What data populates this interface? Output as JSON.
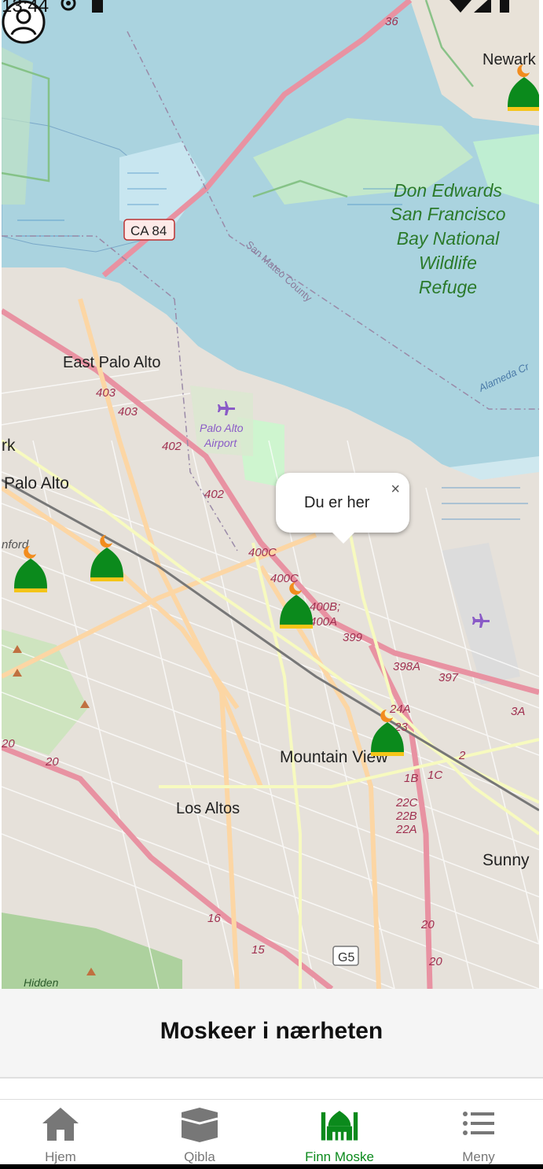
{
  "status_bar": {
    "time": "13:44"
  },
  "map": {
    "labels": {
      "newark": "Newark",
      "refuge_line1": "Don Edwards",
      "refuge_line2": "San Francisco",
      "refuge_line3": "Bay National",
      "refuge_line4": "Wildlife",
      "refuge_line5": "Refuge",
      "ca84": "CA 84",
      "san_mateo_county": "San Mateo County",
      "east_palo_alto": "East Palo Alto",
      "palo_alto_airport_1": "Palo Alto",
      "palo_alto_airport_2": "Airport",
      "palo_alto": "Palo Alto",
      "mountain_view": "Mountain View",
      "los_altos": "Los Altos",
      "sunnyvale": "Sunny",
      "alameda": "Alameda Cr",
      "hidden": "Hidden",
      "exit_403a": "403",
      "exit_403b": "403",
      "exit_402a": "402",
      "exit_402b": "402",
      "exit_400c": "400C",
      "exit_400c2": "400C",
      "exit_400b": "400B;",
      "exit_400a": "400A",
      "exit_399": "399",
      "exit_398a": "398A",
      "exit_397": "397",
      "exit_24a": "24A",
      "exit_23": "23",
      "exit_22c": "22C",
      "exit_22b": "22B",
      "exit_22a": "22A",
      "exit_1b": "1B",
      "exit_1c": "1C",
      "exit_2": "2",
      "exit_3a": "3A",
      "rt_36": "36",
      "rt_20a": "20",
      "rt_20b": "20",
      "rt_20c": "20",
      "rt_20d": "20",
      "rt_16": "16",
      "rt_15": "15",
      "g5": "G5",
      "rk": "rk",
      "stanford": "nford"
    },
    "popup": {
      "text": "Du er her",
      "close": "×"
    }
  },
  "section": {
    "title": "Moskeer i nærheten"
  },
  "bottom_nav": {
    "items": [
      {
        "label": "Hjem",
        "icon": "home-icon"
      },
      {
        "label": "Qibla",
        "icon": "kaaba-icon"
      },
      {
        "label": "Finn Moske",
        "icon": "mosque-icon"
      },
      {
        "label": "Meny",
        "icon": "menu-list-icon"
      }
    ],
    "active_color": "#0b8a1c",
    "inactive_color": "#777777"
  },
  "colors": {
    "water": "#aad3df",
    "land": "#efe9e1",
    "park": "#c8facc",
    "motorway": "#e892a2",
    "primary": "#fcd6a4",
    "mosque_dome": "#0b8a1c",
    "crescent": "#f28c1e"
  }
}
